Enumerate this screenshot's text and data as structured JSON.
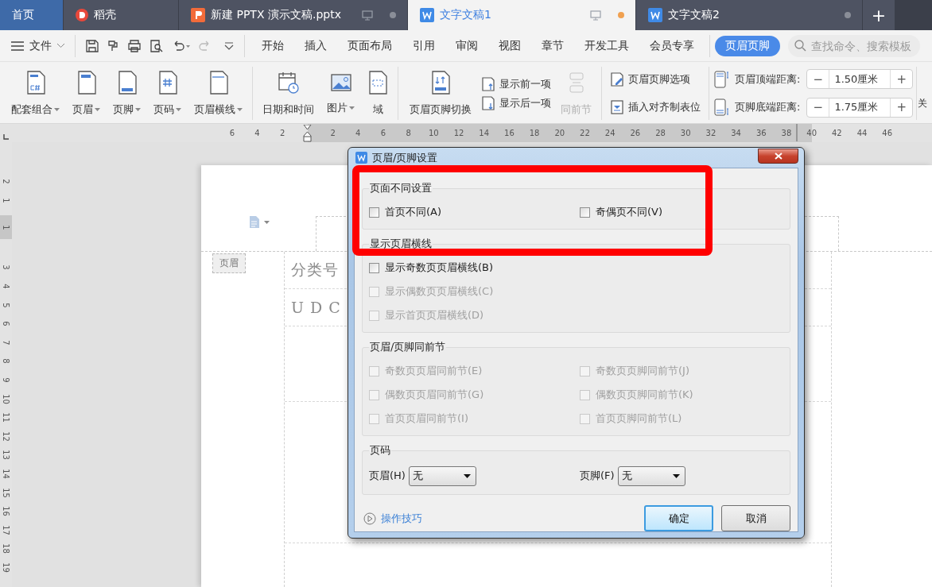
{
  "tabs": [
    {
      "kind": "home",
      "label": "首页",
      "selected": false
    },
    {
      "kind": "docer",
      "label": "稻壳",
      "selected": false
    },
    {
      "kind": "presentation",
      "label": "新建 PPTX 演示文稿.pptx",
      "selected": false,
      "monitor": true,
      "modified": false
    },
    {
      "kind": "writer",
      "label": "文字文稿1",
      "selected": true,
      "monitor": true,
      "modified": true
    },
    {
      "kind": "writer",
      "label": "文字文稿2",
      "selected": false,
      "monitor": false,
      "modified": false
    }
  ],
  "new_tab": "+",
  "menu": {
    "file": "文件",
    "items": [
      {
        "label": "开始",
        "selected": false
      },
      {
        "label": "插入",
        "selected": false
      },
      {
        "label": "页面布局",
        "selected": false
      },
      {
        "label": "引用",
        "selected": false
      },
      {
        "label": "审阅",
        "selected": false
      },
      {
        "label": "视图",
        "selected": false
      },
      {
        "label": "章节",
        "selected": false
      },
      {
        "label": "开发工具",
        "selected": false
      },
      {
        "label": "会员专享",
        "selected": false
      }
    ],
    "context_tab": {
      "label": "页眉页脚",
      "selected": true
    },
    "search": {
      "placeholder": "查找命令、搜索模板"
    }
  },
  "ribbon": {
    "header_footer": [
      {
        "label": "配套组合",
        "dropdown": true
      },
      {
        "label": "页眉",
        "dropdown": true
      },
      {
        "label": "页脚",
        "dropdown": true
      },
      {
        "label": "页码",
        "dropdown": true
      },
      {
        "label": "页眉横线",
        "dropdown": true
      }
    ],
    "insert": [
      {
        "label": "日期和时间",
        "dropdown": false
      },
      {
        "label": "图片",
        "dropdown": true
      },
      {
        "label": "域",
        "dropdown": false
      }
    ],
    "switch": {
      "label": "页眉页脚切换"
    },
    "navigate": [
      {
        "label": "显示前一项"
      },
      {
        "label": "显示后一项"
      }
    ],
    "same_as_previous": {
      "label": "同前节",
      "disabled": true
    },
    "options": [
      {
        "label": "页眉页脚选项"
      },
      {
        "label": "插入对齐制表位"
      }
    ],
    "distances": [
      {
        "label": "页眉顶端距离:",
        "minus": "−",
        "value": "1.50厘米",
        "plus": "+"
      },
      {
        "label": "页脚底端距离:",
        "minus": "−",
        "value": "1.75厘米",
        "plus": "+"
      }
    ],
    "cut_label": "关"
  },
  "ruler": {
    "horizontal": [
      {
        "kind": "number",
        "label": "6"
      },
      {
        "kind": "number",
        "label": "4"
      },
      {
        "kind": "number",
        "label": "2"
      },
      {
        "kind": "indent"
      },
      {
        "kind": "number",
        "label": "2"
      },
      {
        "kind": "number",
        "label": "4"
      },
      {
        "kind": "number",
        "label": "6"
      },
      {
        "kind": "number",
        "label": "8"
      },
      {
        "kind": "number",
        "label": "10"
      },
      {
        "kind": "number",
        "label": "12"
      },
      {
        "kind": "number",
        "label": "14"
      },
      {
        "kind": "number",
        "label": "16"
      },
      {
        "kind": "number",
        "label": "18"
      },
      {
        "kind": "number",
        "label": "20"
      },
      {
        "kind": "number",
        "label": "22"
      },
      {
        "kind": "number",
        "label": "24"
      },
      {
        "kind": "number",
        "label": "26"
      },
      {
        "kind": "number",
        "label": "28"
      },
      {
        "kind": "number",
        "label": "30"
      },
      {
        "kind": "number",
        "label": "32"
      },
      {
        "kind": "number",
        "label": "34"
      },
      {
        "kind": "number",
        "label": "36"
      },
      {
        "kind": "number",
        "label": "38"
      },
      {
        "kind": "margin",
        "label": "40"
      },
      {
        "kind": "number",
        "label": "42"
      },
      {
        "kind": "number",
        "label": "44"
      },
      {
        "kind": "number",
        "label": "46"
      }
    ],
    "vertical": [
      {
        "kind": "number",
        "label": "2"
      },
      {
        "kind": "number",
        "label": "1"
      },
      {
        "kind": "shaded",
        "label": "1"
      },
      {
        "kind": "number",
        "label": "3"
      },
      {
        "kind": "number",
        "label": "4"
      },
      {
        "kind": "number",
        "label": "5"
      },
      {
        "kind": "number",
        "label": "6"
      },
      {
        "kind": "number",
        "label": "7"
      },
      {
        "kind": "number",
        "label": "8"
      },
      {
        "kind": "number",
        "label": "9"
      },
      {
        "kind": "number",
        "label": "10"
      },
      {
        "kind": "number",
        "label": "11"
      },
      {
        "kind": "number",
        "label": "12"
      },
      {
        "kind": "number",
        "label": "13"
      },
      {
        "kind": "number",
        "label": "14"
      },
      {
        "kind": "number",
        "label": "15"
      },
      {
        "kind": "number",
        "label": "16"
      },
      {
        "kind": "number",
        "label": "17"
      },
      {
        "kind": "number",
        "label": "18"
      },
      {
        "kind": "number",
        "label": "19"
      }
    ]
  },
  "document": {
    "header_tag": "页眉",
    "cells": [
      "分类号",
      "U D C"
    ]
  },
  "dialog": {
    "title": "页眉/页脚设置",
    "sections": [
      {
        "title": "页面不同设置",
        "rows": [
          [
            {
              "label": "首页不同(A)",
              "checked": false,
              "disabled": false
            },
            {
              "label": "奇偶页不同(V)",
              "checked": false,
              "disabled": false
            }
          ]
        ]
      },
      {
        "title": "显示页眉横线",
        "rows": [
          [
            {
              "label": "显示奇数页页眉横线(B)",
              "checked": false,
              "disabled": false
            }
          ],
          [
            {
              "label": "显示偶数页页眉横线(C)",
              "checked": false,
              "disabled": true
            }
          ],
          [
            {
              "label": "显示首页页眉横线(D)",
              "checked": false,
              "disabled": true
            }
          ]
        ]
      },
      {
        "title": "页眉/页脚同前节",
        "rows": [
          [
            {
              "label": "奇数页页眉同前节(E)",
              "checked": false,
              "disabled": true
            },
            {
              "label": "奇数页页脚同前节(J)",
              "checked": false,
              "disabled": true
            }
          ],
          [
            {
              "label": "偶数页页眉同前节(G)",
              "checked": false,
              "disabled": true
            },
            {
              "label": "偶数页页脚同前节(K)",
              "checked": false,
              "disabled": true
            }
          ],
          [
            {
              "label": "首页页眉同前节(I)",
              "checked": false,
              "disabled": true
            },
            {
              "label": "首页页脚同前节(L)",
              "checked": false,
              "disabled": true
            }
          ]
        ]
      }
    ],
    "page_number": {
      "title": "页码",
      "fields": [
        {
          "label": "页眉(H)",
          "value": "无"
        },
        {
          "label": "页脚(F)",
          "value": "无"
        }
      ]
    },
    "help_link": "操作技巧",
    "buttons": [
      {
        "label": "确定",
        "default": true
      },
      {
        "label": "取消",
        "default": false
      }
    ]
  },
  "annotation": {
    "kind": "frame"
  }
}
